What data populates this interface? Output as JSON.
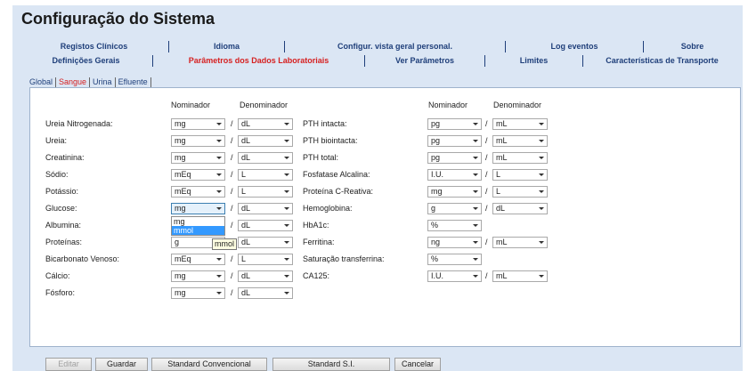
{
  "title": "Configuração do Sistema",
  "tabs_row1": [
    "Registos Clínicos",
    "Idioma",
    "Configur. vista geral personal.",
    "Log eventos",
    "Sobre"
  ],
  "tabs_row2": [
    "Definições Gerais",
    "Parâmetros dos Dados Laboratoriais",
    "Ver Parâmetros",
    "Limites",
    "Características de Transporte"
  ],
  "active_tab_row2": "Parâmetros dos Dados Laboratoriais",
  "subtabs": [
    "Global",
    "Sangue",
    "Urina",
    "Efluente"
  ],
  "active_subtab": "Sangue",
  "headers": {
    "nominador": "Nominador",
    "denominador": "Denominador"
  },
  "left_params": [
    {
      "label": "Ureia Nitrogenada:",
      "nom": "mg",
      "den": "dL"
    },
    {
      "label": "Ureia:",
      "nom": "mg",
      "den": "dL"
    },
    {
      "label": "Creatinina:",
      "nom": "mg",
      "den": "dL"
    },
    {
      "label": "Sódio:",
      "nom": "mEq",
      "den": "L"
    },
    {
      "label": "Potássio:",
      "nom": "mEq",
      "den": "L"
    },
    {
      "label": "Glucose:",
      "nom": "mg",
      "den": "dL"
    },
    {
      "label": "Albumina:",
      "nom": "",
      "den": "dL"
    },
    {
      "label": "Proteínas:",
      "nom": "g",
      "den": "dL"
    },
    {
      "label": "Bicarbonato Venoso:",
      "nom": "mEq",
      "den": "L"
    },
    {
      "label": "Cálcio:",
      "nom": "mg",
      "den": "dL"
    },
    {
      "label": "Fósforo:",
      "nom": "mg",
      "den": "dL"
    }
  ],
  "right_params": [
    {
      "label": "PTH intacta:",
      "nom": "pg",
      "den": "mL"
    },
    {
      "label": "PTH biointacta:",
      "nom": "pg",
      "den": "mL"
    },
    {
      "label": "PTH total:",
      "nom": "pg",
      "den": "mL"
    },
    {
      "label": "Fosfatase Alcalina:",
      "nom": "I.U.",
      "den": "L"
    },
    {
      "label": "Proteína C-Reativa:",
      "nom": "mg",
      "den": "L"
    },
    {
      "label": "Hemoglobina:",
      "nom": "g",
      "den": "dL"
    },
    {
      "label": "HbA1c:",
      "nom": "%",
      "den": null
    },
    {
      "label": "Ferritina:",
      "nom": "ng",
      "den": "mL"
    },
    {
      "label": "Saturação transferrina:",
      "nom": "%",
      "den": null
    },
    {
      "label": "CA125:",
      "nom": "I.U.",
      "den": "mL"
    }
  ],
  "glucose_dropdown": {
    "options": [
      "mg",
      "mmol"
    ],
    "highlighted": "mmol",
    "tooltip": "mmol"
  },
  "buttons": [
    "Editar",
    "Guardar",
    "Standard Convencional",
    "Standard S.I.",
    "Cancelar"
  ]
}
